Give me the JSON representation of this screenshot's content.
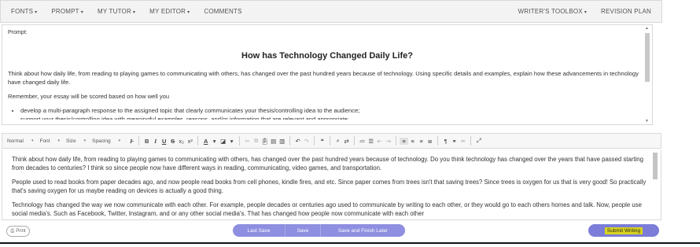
{
  "topnav": {
    "left": [
      {
        "label": "FONTS",
        "caret": true
      },
      {
        "label": "PROMPT",
        "caret": true
      },
      {
        "label": "MY TUTOR",
        "caret": true
      },
      {
        "label": "MY EDITOR",
        "caret": true
      },
      {
        "label": "COMMENTS",
        "caret": false
      }
    ],
    "right": [
      {
        "label": "WRITER'S TOOLBOX",
        "caret": true
      },
      {
        "label": "REVISION PLAN",
        "caret": false
      }
    ]
  },
  "prompt": {
    "label": "Prompt:",
    "title": "How has Technology Changed Daily Life?",
    "paragraph1": "Think about how daily life, from reading to playing games to communicating with others, has changed over the past hundred years because of technology. Using specific details and examples, explain how these advancements in technology have changed daily life.",
    "paragraph2": "Remember, your essay will be scored based on how well you",
    "bullet1": "develop a multi-paragraph response to the assigned topic that clearly communicates your thesis/controlling idea to the audience;",
    "bullet2": "support your thesis/controlling idea with meaningful examples, reasons, and/or information that are relevant and appropriate;"
  },
  "toolbar": {
    "style_select": "Normal",
    "font_select": "Font",
    "size_select": "Size",
    "spacing_select": "Spacing"
  },
  "editor": {
    "paragraphs": [
      "Think about how daily life, from reading to playing games to communicating with others, has changed over the past hundred years because of technology. Do you think technology has changed over the years that have passed starting from decades to centuries? I  think so since people now have different ways in reading, communicating, video games, and transportation.",
      "People used to read books from paper decades ago, and now people read books from cell phones, kindle fires, and etc. Since paper comes from trees isn't that saving trees? Since trees is oxygen for us that is very good! So practically that's saving oxygen for us maybe reading on devices is actually a good thing.",
      "Technology has changed the way we now communicate with each other. For example, people decades or centuries ago used to communicate by writing to each other, or they would go to each others homes and talk. Now, people use social media's. Such as Facebook, Twitter, Instagram, and or any other social media's. That has changed how people now communicate with each other"
    ]
  },
  "bottom": {
    "print_label": "Print",
    "last_save_label": "Last Save",
    "save_label": "Save",
    "save_finish_label": "Save and Finish Later",
    "submit_label": "Submit Writing"
  },
  "colors": {
    "pill": "#8e8fe0",
    "submit": "#7b7dd8",
    "submit_highlight": "#d9d420"
  }
}
